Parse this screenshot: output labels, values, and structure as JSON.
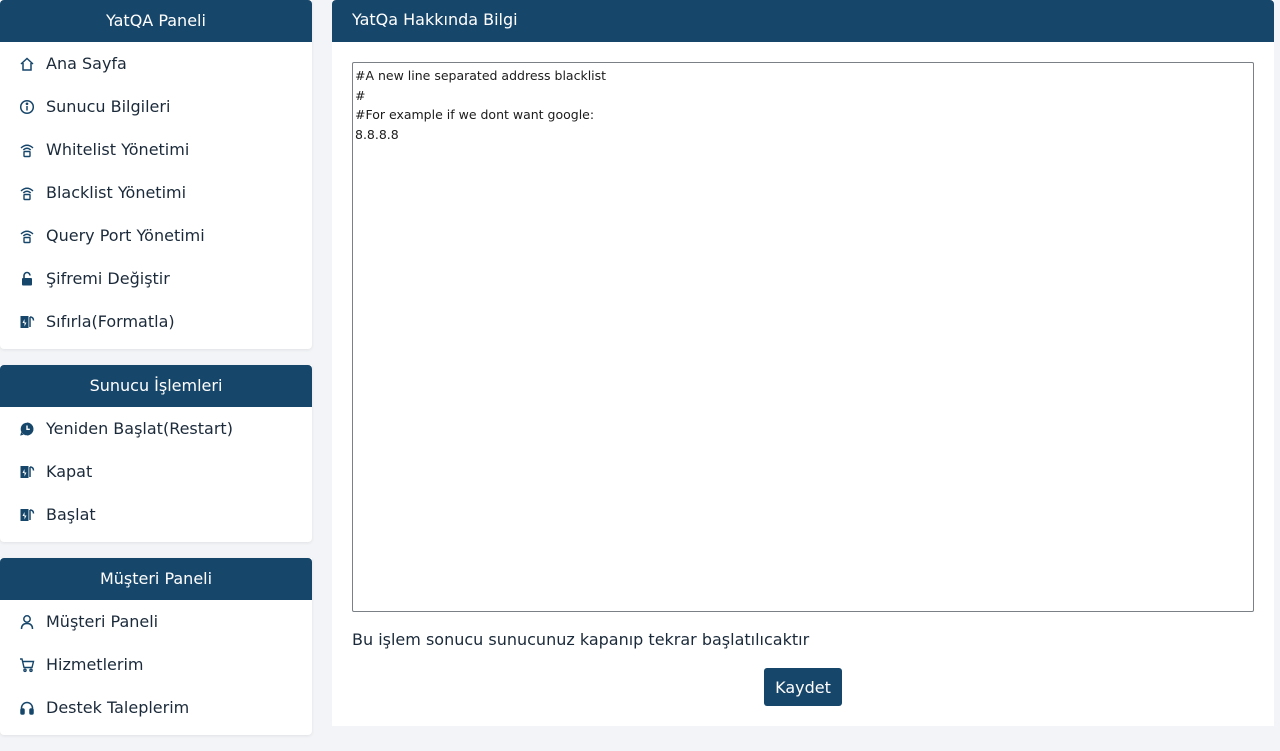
{
  "sidebar": {
    "panels": [
      {
        "title": "YatQA Paneli",
        "items": [
          {
            "label": "Ana Sayfa",
            "icon": "home-icon"
          },
          {
            "label": "Sunucu Bilgileri",
            "icon": "info-icon"
          },
          {
            "label": "Whitelist Yönetimi",
            "icon": "wifi-lock-icon"
          },
          {
            "label": "Blacklist Yönetimi",
            "icon": "wifi-lock-icon"
          },
          {
            "label": "Query Port Yönetimi",
            "icon": "wifi-lock-icon"
          },
          {
            "label": "Şifremi Değiştir",
            "icon": "unlock-icon"
          },
          {
            "label": "Sıfırla(Formatla)",
            "icon": "reset-icon"
          }
        ]
      },
      {
        "title": "Sunucu İşlemleri",
        "items": [
          {
            "label": "Yeniden Başlat(Restart)",
            "icon": "restart-icon"
          },
          {
            "label": "Kapat",
            "icon": "reset-icon"
          },
          {
            "label": "Başlat",
            "icon": "reset-icon"
          }
        ]
      },
      {
        "title": "Müşteri Paneli",
        "items": [
          {
            "label": "Müşteri Paneli",
            "icon": "user-icon"
          },
          {
            "label": "Hizmetlerim",
            "icon": "cart-icon"
          },
          {
            "label": "Destek Taleplerim",
            "icon": "headset-icon"
          }
        ]
      }
    ]
  },
  "main": {
    "title": "YatQa Hakkında Bilgi",
    "editor_value": "#A new line separated address blacklist\n#\n#For example if we dont want google:\n8.8.8.8",
    "note": "Bu işlem sonucu sunucunuz kapanıp tekrar başlatılıcaktır",
    "save_label": "Kaydet"
  },
  "colors": {
    "primary": "#17466b",
    "text": "#1b2a3a"
  }
}
